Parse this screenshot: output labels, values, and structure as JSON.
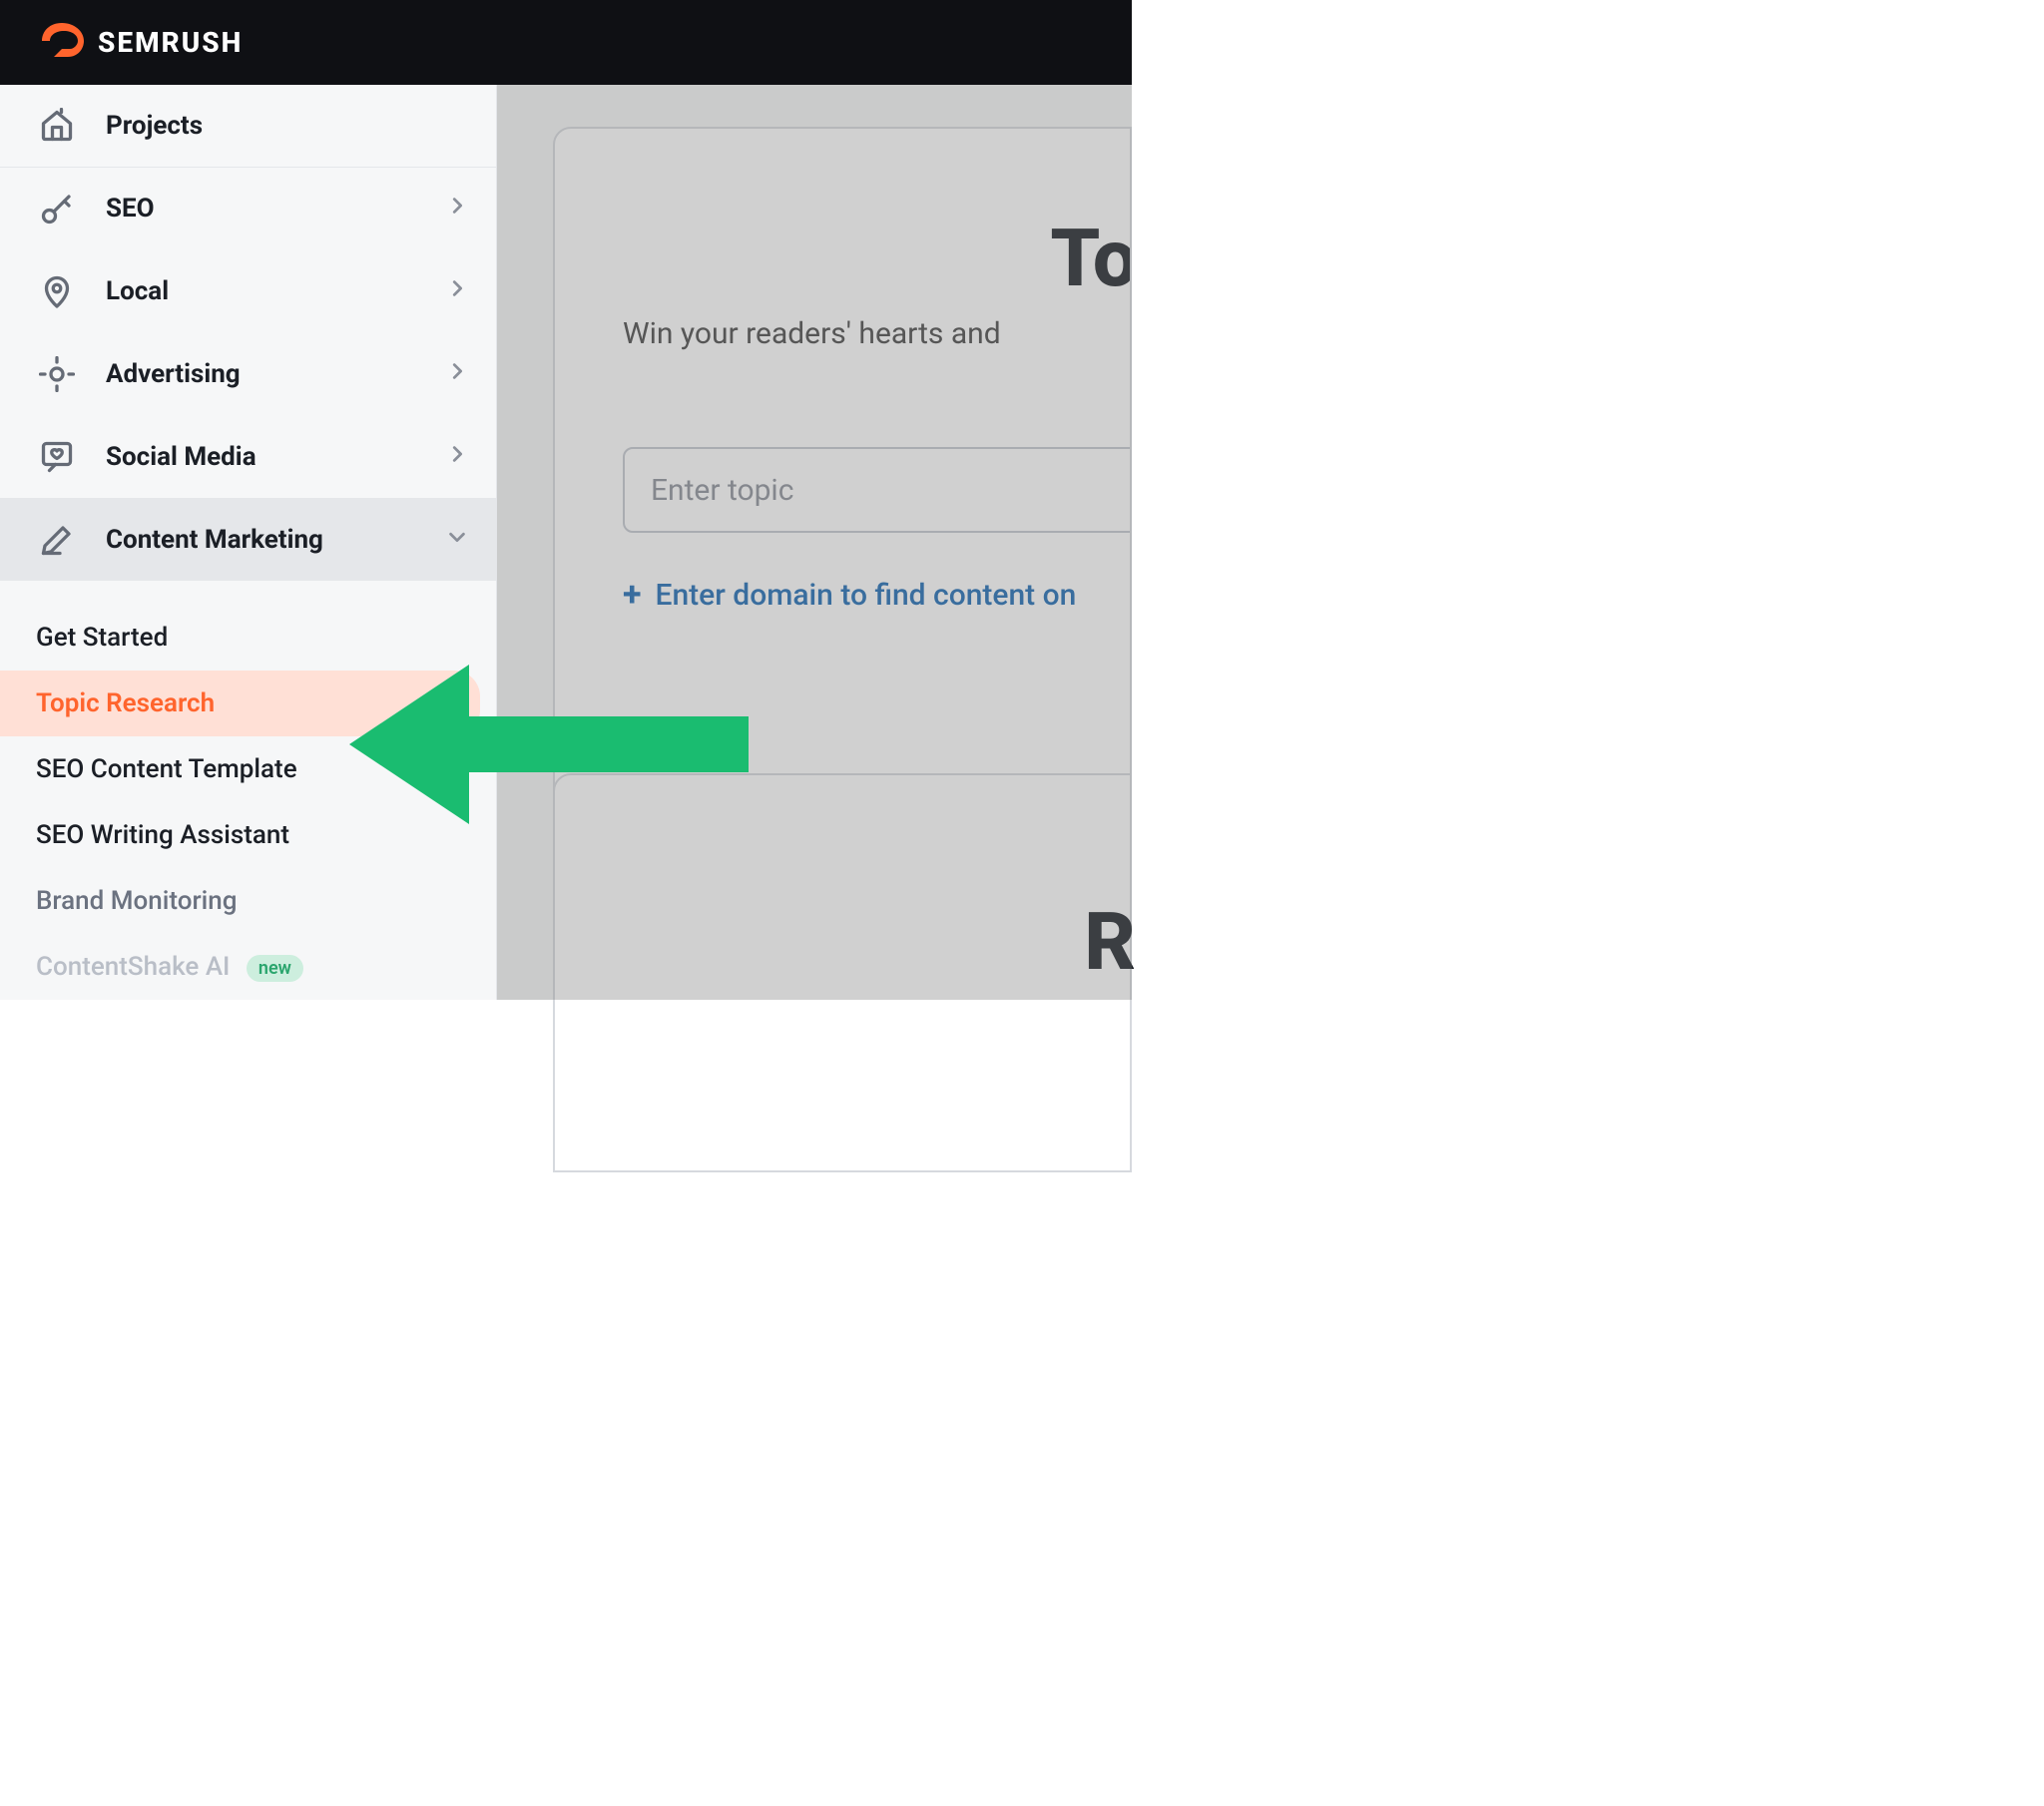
{
  "brand": {
    "name": "SEMRUSH"
  },
  "sidebar": {
    "projects_label": "Projects",
    "groups": [
      {
        "label": "SEO"
      },
      {
        "label": "Local"
      },
      {
        "label": "Advertising"
      },
      {
        "label": "Social Media"
      },
      {
        "label": "Content Marketing",
        "expanded": true
      }
    ],
    "submenu": [
      {
        "label": "Get Started"
      },
      {
        "label": "Topic Research",
        "active": true
      },
      {
        "label": "SEO Content Template"
      },
      {
        "label": "SEO Writing Assistant"
      },
      {
        "label": "Brand Monitoring",
        "muted": true
      },
      {
        "label": "ContentShake AI",
        "faded": true,
        "badge": "new"
      }
    ]
  },
  "main": {
    "title_fragment": "To",
    "subtitle": "Win your readers' hearts and",
    "topic_placeholder": "Enter topic",
    "domain_link": "Enter domain to find content on",
    "card2_letter": "R"
  }
}
